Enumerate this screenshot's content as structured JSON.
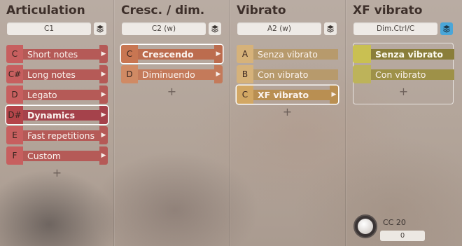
{
  "columns": [
    {
      "title": "Articulation",
      "key_field": "C1",
      "layer_active": false,
      "items": [
        {
          "key": "C",
          "label": "Short notes",
          "selected": false
        },
        {
          "key": "C#",
          "label": "Long notes",
          "selected": false
        },
        {
          "key": "D",
          "label": "Legato",
          "selected": false
        },
        {
          "key": "D#",
          "label": "Dynamics",
          "selected": true
        },
        {
          "key": "E",
          "label": "Fast repetitions",
          "selected": false
        },
        {
          "key": "F",
          "label": "Custom",
          "selected": false
        }
      ],
      "add_label": "+"
    },
    {
      "title": "Cresc. / dim.",
      "key_field": "C2 (w)",
      "layer_active": false,
      "items": [
        {
          "key": "C",
          "label": "Crescendo",
          "selected": true
        },
        {
          "key": "D",
          "label": "Diminuendo",
          "selected": false
        }
      ],
      "add_label": "+"
    },
    {
      "title": "Vibrato",
      "key_field": "A2 (w)",
      "layer_active": false,
      "items": [
        {
          "key": "A",
          "label": "Senza vibrato",
          "selected": false
        },
        {
          "key": "B",
          "label": "Con vibrato",
          "selected": false
        },
        {
          "key": "C",
          "label": "XF vibrato",
          "selected": true
        }
      ],
      "add_label": "+"
    },
    {
      "title": "XF vibrato",
      "key_field": "Dim.Ctrl/C",
      "layer_active": true,
      "items": [
        {
          "key": "",
          "label": "Senza vibrato",
          "selected": true
        },
        {
          "key": "",
          "label": "Con vibrato",
          "selected": false
        }
      ],
      "add_label": "+",
      "cc": {
        "label": "CC 20",
        "value": "0"
      }
    }
  ],
  "icons": {
    "layer": "layers-icon",
    "arrow": "chevron-right-icon",
    "knob": "knob-icon"
  },
  "colors": {
    "selected_outline": "#ffffff",
    "layer_active": "#4aa6d8"
  }
}
